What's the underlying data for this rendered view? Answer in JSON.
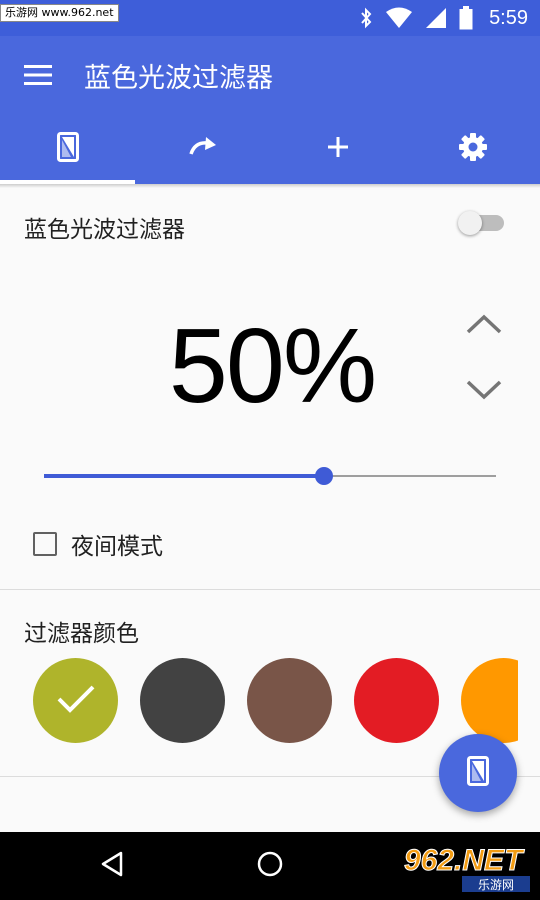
{
  "status_bar": {
    "watermark": "乐游网 www.962.net",
    "time": "5:59",
    "icons": [
      "bluetooth-icon",
      "wifi-icon",
      "signal-icon",
      "battery-icon"
    ]
  },
  "app_bar": {
    "title": "蓝色光波过滤器",
    "menu_icon": "hamburger-menu-icon"
  },
  "tabs": [
    {
      "icon": "phone-filter-icon",
      "active": true
    },
    {
      "icon": "redo-arrow-icon",
      "active": false
    },
    {
      "icon": "plus-icon",
      "active": false
    },
    {
      "icon": "gear-icon",
      "active": false
    }
  ],
  "filter": {
    "label": "蓝色光波过滤器",
    "enabled": false
  },
  "intensity": {
    "display": "50%",
    "slider_value": 0.62
  },
  "night_mode": {
    "label": "夜间模式",
    "checked": false
  },
  "filter_colors": {
    "title": "过滤器颜色",
    "swatches": [
      {
        "name": "olive",
        "color": "#afb42b",
        "selected": true
      },
      {
        "name": "dark-gray",
        "color": "#424242",
        "selected": false
      },
      {
        "name": "brown",
        "color": "#795548",
        "selected": false
      },
      {
        "name": "red",
        "color": "#e31c24",
        "selected": false
      },
      {
        "name": "orange",
        "color": "#ff9800",
        "selected": false
      }
    ]
  },
  "fab": {
    "icon": "phone-filter-icon"
  },
  "nav_bar": {
    "buttons": [
      "back-icon",
      "home-icon"
    ],
    "logo_text": "962.NET",
    "logo_subtext": "乐游网"
  },
  "colors": {
    "primary": "#4a68dd",
    "status_bar": "#3e5ed9",
    "accent": "#3f5bd6"
  }
}
